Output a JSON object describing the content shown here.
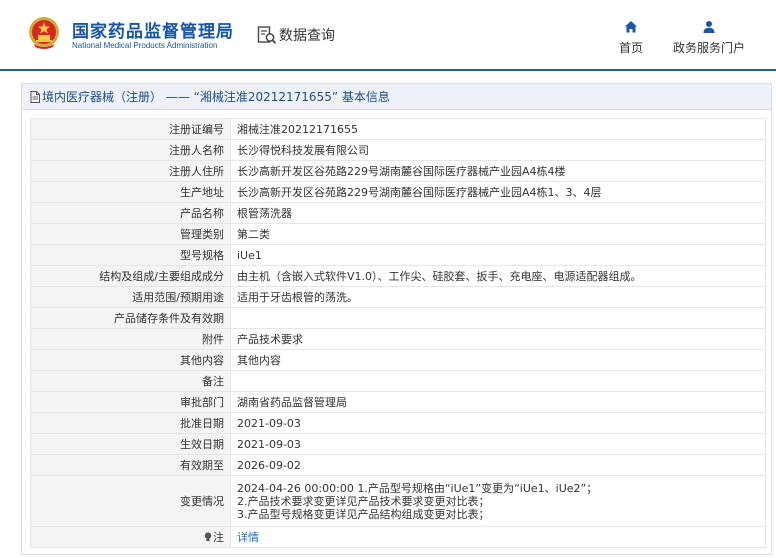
{
  "header": {
    "brand_cn": "国家药品监督管理局",
    "brand_en": "National Medical Products Administration",
    "search_label": "数据查询",
    "nav": {
      "home": "首页",
      "portal": "政务服务门户"
    }
  },
  "panel": {
    "title": "境内医疗器械（注册） —— “湘械注准20212171655” 基本信息"
  },
  "rows": [
    {
      "key": "注册证编号",
      "value": "湘械注准20212171655"
    },
    {
      "key": "注册人名称",
      "value": "长沙得悦科技发展有限公司"
    },
    {
      "key": "注册人住所",
      "value": "长沙高新开发区谷苑路229号湖南麓谷国际医疗器械产业园A4栋4楼"
    },
    {
      "key": "生产地址",
      "value": "长沙高新开发区谷苑路229号湖南麓谷国际医疗器械产业园A4栋1、3、4层"
    },
    {
      "key": "产品名称",
      "value": "根管荡洗器"
    },
    {
      "key": "管理类别",
      "value": "第二类"
    },
    {
      "key": "型号规格",
      "value": "iUe1"
    },
    {
      "key": "结构及组成/主要组成成分",
      "value": "由主机（含嵌入式软件V1.0）、工作尖、硅胶套、扳手、充电座、电源适配器组成。"
    },
    {
      "key": "适用范围/预期用途",
      "value": "适用于牙齿根管的荡洗。"
    },
    {
      "key": "产品储存条件及有效期",
      "value": ""
    },
    {
      "key": "附件",
      "value": "产品技术要求"
    },
    {
      "key": "其他内容",
      "value": "其他内容"
    },
    {
      "key": "备注",
      "value": ""
    },
    {
      "key": "审批部门",
      "value": "湖南省药品监督管理局"
    },
    {
      "key": "批准日期",
      "value": "2021-09-03"
    },
    {
      "key": "生效日期",
      "value": "2021-09-03"
    },
    {
      "key": "有效期至",
      "value": "2026-09-02"
    }
  ],
  "change": {
    "key": "变更情况",
    "lines": [
      "2024-04-26 00:00:00 1.产品型号规格由“iUe1”变更为“iUe1、iUe2”；",
      "2.产品技术要求变更详见产品技术要求变更对比表；",
      "3.产品型号规格变更详见产品结构组成变更对比表；"
    ]
  },
  "note": {
    "key": "注",
    "link": "详情"
  },
  "colors": {
    "brand_blue": "#1a56a4",
    "header_line": "#1c5e9f",
    "title_bar": "#eef2f8",
    "key_bg": "#f4f4f4",
    "link": "#1a6ec8"
  },
  "icons": {
    "emblem": "national-emblem-icon",
    "search": "data-search-icon",
    "home": "home-icon",
    "portal": "user-icon",
    "doc": "document-icon",
    "note": "lightbulb-icon"
  }
}
